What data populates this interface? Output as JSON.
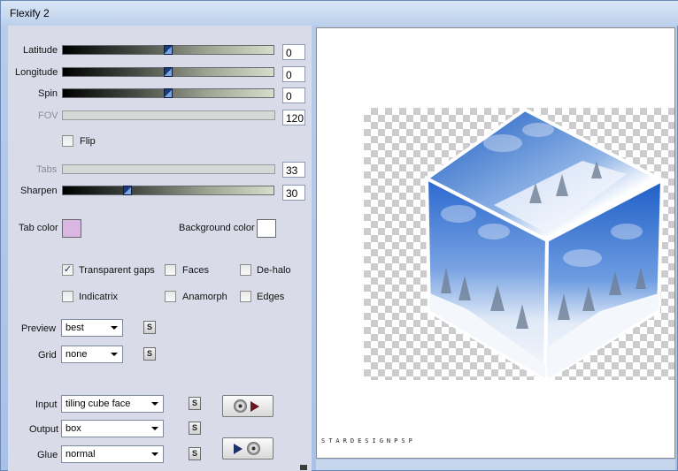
{
  "window": {
    "title": "Flexify 2"
  },
  "controls": {
    "latitude": {
      "label": "Latitude",
      "value": "0",
      "fraction": 0.5
    },
    "longitude": {
      "label": "Longitude",
      "value": "0",
      "fraction": 0.5
    },
    "spin": {
      "label": "Spin",
      "value": "0",
      "fraction": 0.5
    },
    "fov": {
      "label": "FOV",
      "value": "120",
      "enabled": false
    },
    "flip": {
      "label": "Flip",
      "checked": false
    },
    "tabs": {
      "label": "Tabs",
      "value": "33",
      "enabled": false
    },
    "sharpen": {
      "label": "Sharpen",
      "value": "30",
      "fraction": 0.3
    }
  },
  "colors": {
    "tab_color": {
      "label": "Tab color",
      "hex": "#dab7e3"
    },
    "background_color": {
      "label": "Background color",
      "hex": "#ffffff"
    }
  },
  "checkboxes": {
    "transparent_gaps": {
      "label": "Transparent gaps",
      "checked": true
    },
    "faces": {
      "label": "Faces",
      "checked": false
    },
    "de_halo": {
      "label": "De-halo",
      "checked": false
    },
    "indicatrix": {
      "label": "Indicatrix",
      "checked": false
    },
    "anamorph": {
      "label": "Anamorph",
      "checked": false
    },
    "edges": {
      "label": "Edges",
      "checked": false
    }
  },
  "dropdowns": {
    "preview": {
      "label": "Preview",
      "value": "best"
    },
    "grid": {
      "label": "Grid",
      "value": "none"
    },
    "input": {
      "label": "Input",
      "value": "tiling cube face"
    },
    "output": {
      "label": "Output",
      "value": "box"
    },
    "glue": {
      "label": "Glue",
      "value": "normal"
    }
  },
  "small_button_label": "S",
  "icons": {
    "checkmark": "✓",
    "input_convert": "disc-to-play-icon",
    "output_convert": "play-to-disc-icon"
  },
  "preview_image": {
    "description_colors": {
      "sky": "#2f6fd0",
      "snow": "#f2f5fb",
      "cloud": "#a9c6ee"
    },
    "watermark": "STARDESIGNPSP"
  },
  "accent": {
    "slider_thumb": "#1a3a78",
    "title_bar": "#bcd0ec"
  }
}
